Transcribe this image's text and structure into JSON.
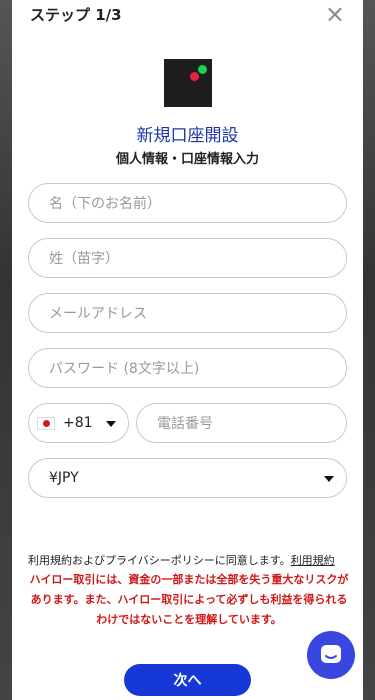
{
  "header": {
    "step_label": "ステップ 1/3",
    "close_glyph": "×"
  },
  "brand": {
    "title": "新規口座開設",
    "subtitle": "個人情報・口座情報入力"
  },
  "form": {
    "first_name_placeholder": "名（下のお名前）",
    "last_name_placeholder": "姓（苗字）",
    "email_placeholder": "メールアドレス",
    "password_placeholder": "パスワード (8文字以上)",
    "phone_country_code": "+81",
    "phone_number_placeholder": "電話番号",
    "currency_value": "¥JPY"
  },
  "legal": {
    "consent_text": "利用規約およびプライバシーポリシーに同意します。",
    "terms_link": "利用規約",
    "risk_warning": "ハイロー取引には、資金の一部または全部を失う重大なリスクがあります。また、ハイロー取引によって必ずしも利益を得られるわけではないことを理解しています。"
  },
  "actions": {
    "next_label": "次へ"
  },
  "colors": {
    "accent": "#1538d6",
    "title": "#1d35a8",
    "warning": "#d01818",
    "chat": "#3a46e0"
  },
  "icons": {
    "close": "close-icon",
    "flag": "japan-flag-icon",
    "dropdown": "chevron-down-icon",
    "chat": "chat-icon"
  }
}
